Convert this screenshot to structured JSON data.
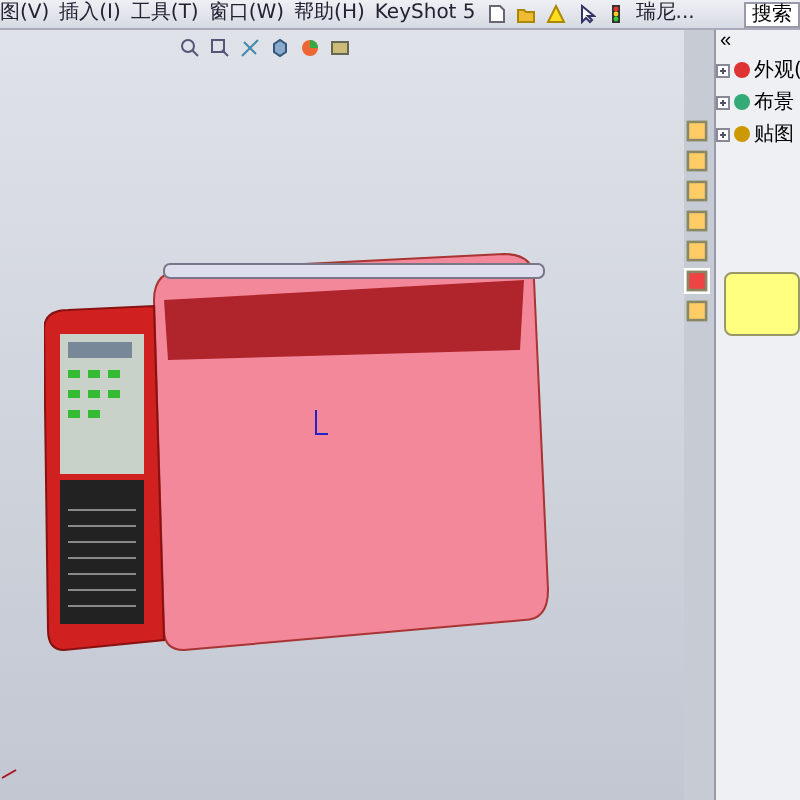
{
  "menu": [
    "图(V)",
    "插入(I)",
    "工具(T)",
    "窗口(W)",
    "帮助(H)",
    "KeyShot 5"
  ],
  "toolbar": {
    "user": "瑞尼...",
    "search": "搜索"
  },
  "side_tabs": [
    {
      "selected": false
    },
    {
      "selected": false
    },
    {
      "selected": false
    },
    {
      "selected": false
    },
    {
      "selected": false
    },
    {
      "selected": true
    },
    {
      "selected": false
    }
  ],
  "tree": [
    {
      "label": "外观(",
      "expanded": false
    },
    {
      "label": "布景",
      "expanded": false
    },
    {
      "label": "贴图",
      "expanded": false
    }
  ],
  "panel": {
    "collapse": "«"
  }
}
